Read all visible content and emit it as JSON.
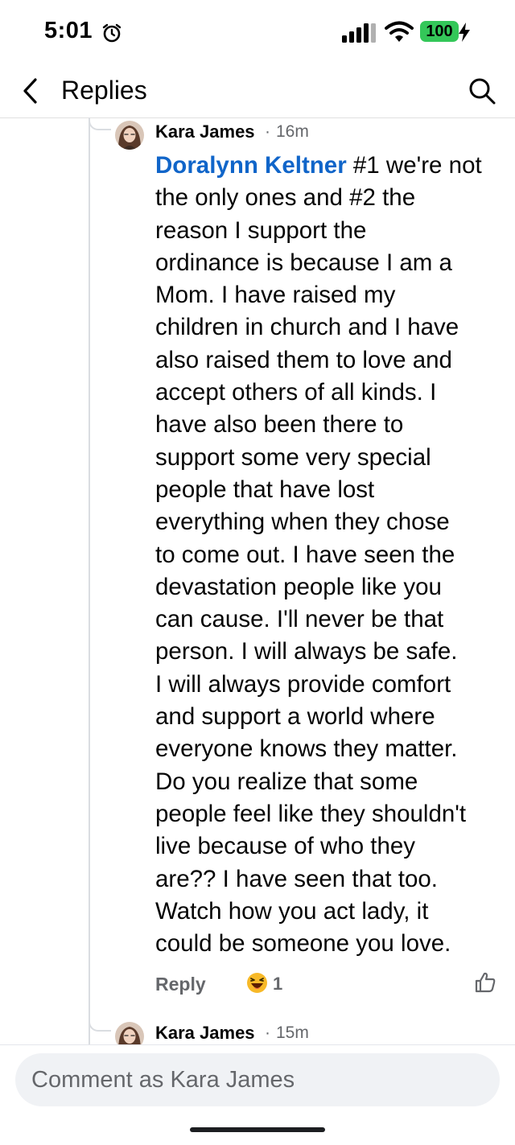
{
  "status": {
    "time": "5:01",
    "battery": "100"
  },
  "header": {
    "title": "Replies"
  },
  "comment": {
    "author": "Kara James",
    "separator": "·",
    "time": "16m",
    "mention": "Doralynn Keltner",
    "lines": [
      " #1 we're not",
      "the only ones and #2 the",
      "reason I support the",
      "ordinance is because I am a",
      "Mom. I have raised my",
      "children in church and I have",
      "also raised them to love and",
      "accept others of all kinds. I",
      "have also been there to",
      "support some very special",
      "people that have lost",
      "everything when they chose",
      "to come out. I have seen the",
      "devastation people like you",
      "can cause. I'll never be that",
      "person. I will always be safe.",
      "I will always provide comfort",
      "and support a world where",
      "everyone knows they matter.",
      "Do you realize that some",
      "people feel like they shouldn't",
      "live because of who they",
      "are?? I have seen that too.",
      "Watch how you act lady, it",
      "could be someone you love."
    ],
    "reply_label": "Reply",
    "reaction_count": "1"
  },
  "next_comment": {
    "author": "Kara James",
    "separator": "·",
    "time": "15m"
  },
  "composer": {
    "placeholder": "Comment as Kara James"
  },
  "colors": {
    "mention": "#1065c9",
    "battery": "#34c759",
    "muted": "#65676b"
  },
  "icons": [
    "alarm-icon",
    "signal-icon",
    "wifi-icon",
    "bolt-icon",
    "back-icon",
    "search-icon",
    "laughing-emoji-icon",
    "like-icon"
  ]
}
